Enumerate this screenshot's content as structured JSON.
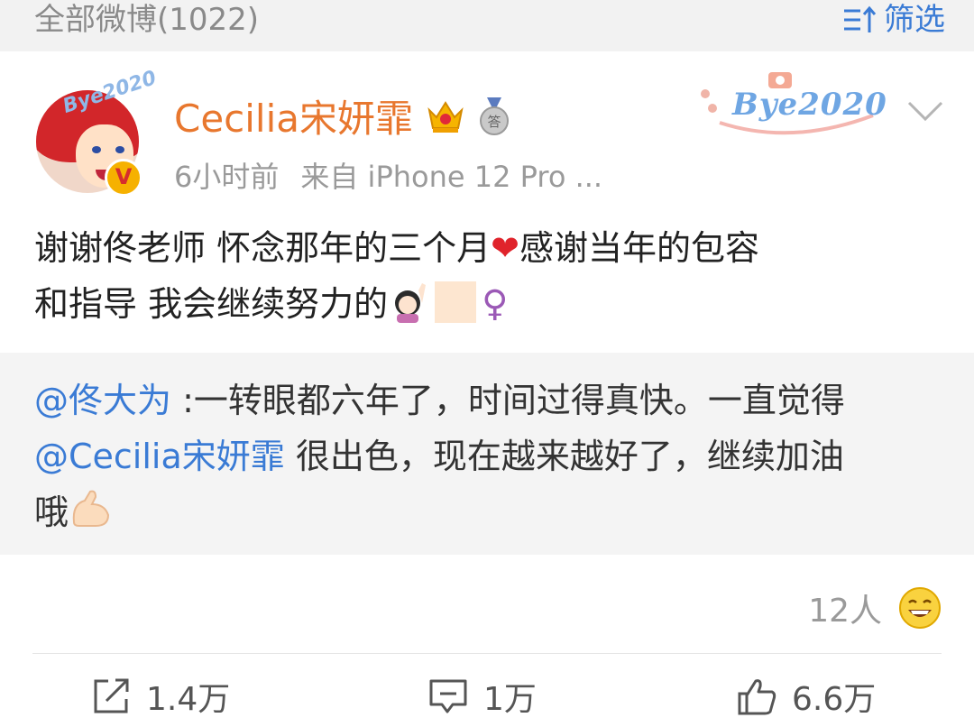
{
  "header": {
    "title": "全部微博(1022)",
    "filter_label": "筛选"
  },
  "post": {
    "username": "Cecilia宋妍霏",
    "time": "6小时前",
    "source": "来自 iPhone 12 Pro ...",
    "avatar_sticker": "Bye2020",
    "badge_text": "Bye2020",
    "text_line1_a": "谢谢佟老师 怀念那年的三个月",
    "text_line1_b": "感谢当年的包容",
    "text_line2": "和指导 我会继续努力的",
    "heart_emoji": "❤",
    "female_symbol": "♀"
  },
  "repost": {
    "mention1": "@佟大为",
    "text1": " :一转眼都六年了，时间过得真快。一直觉得",
    "mention2": "@Cecilia宋妍霏",
    "text2": " 很出色，现在越来越好了，继续加油",
    "text3": "哦"
  },
  "reaction": {
    "count": "12人"
  },
  "actions": {
    "share_count": "1.4万",
    "comment_count": "1万",
    "like_count": "6.6万"
  },
  "colors": {
    "username": "#e8772e",
    "link": "#3a7bd5",
    "muted": "#9a9a9a"
  }
}
